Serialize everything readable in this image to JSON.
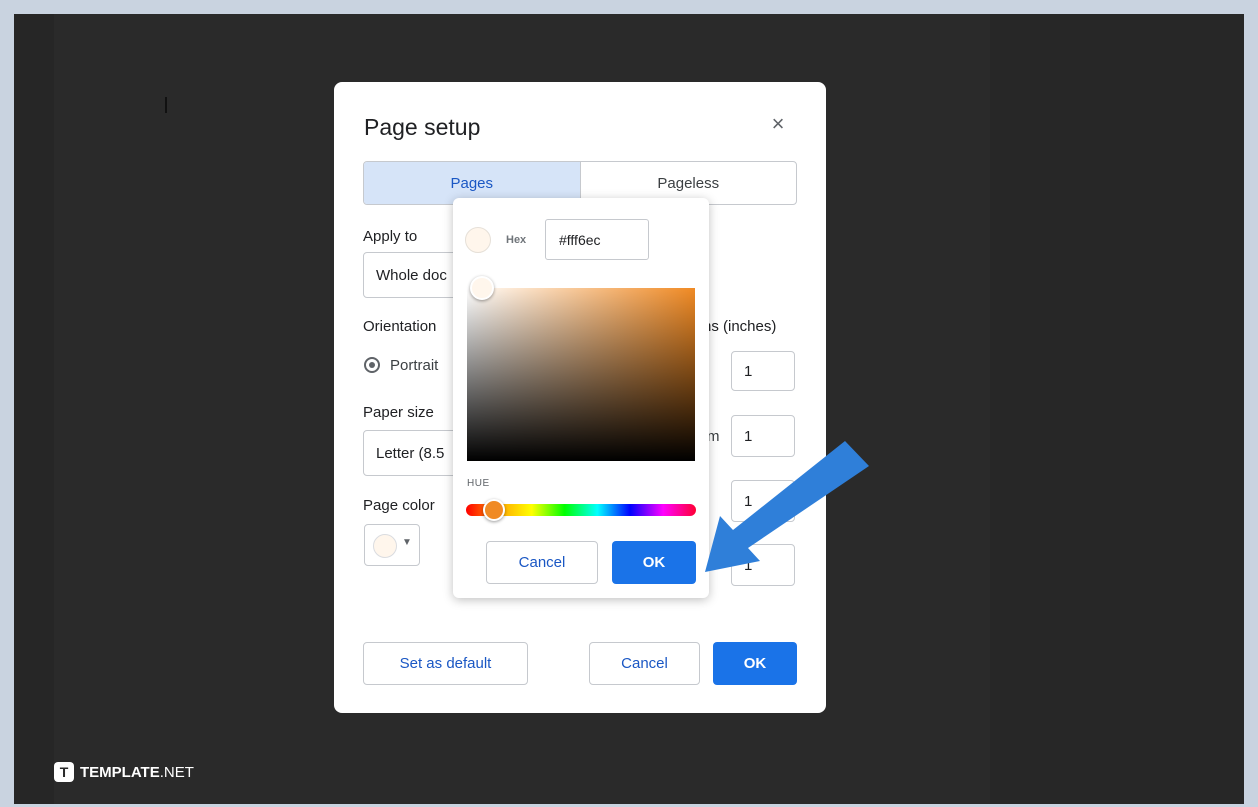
{
  "dialog": {
    "title": "Page setup",
    "tabs": [
      {
        "label": "Pages",
        "active": true
      },
      {
        "label": "Pageless",
        "active": false
      }
    ],
    "apply_to": {
      "label": "Apply to",
      "value": "Whole doc"
    },
    "orientation": {
      "label": "Orientation",
      "option": "Portrait"
    },
    "paper_size": {
      "label": "Paper size",
      "value": "Letter (8.5"
    },
    "page_color": {
      "label": "Page color"
    },
    "margins": {
      "label_suffix": "ns (inches)",
      "values": [
        "1",
        "1",
        "1",
        "1"
      ],
      "side_letter": "m"
    },
    "buttons": {
      "set_default": "Set as default",
      "cancel": "Cancel",
      "ok": "OK"
    }
  },
  "color_picker": {
    "hex_label": "Hex",
    "hex_value": "#fff6ec",
    "hue_label": "HUE",
    "cancel": "Cancel",
    "ok": "OK",
    "selected_color": "#fff6ec",
    "hue_color": "#f08a24"
  },
  "brand": {
    "logo": "T",
    "name_bold": "TEMPLATE",
    "name_suffix": ".NET"
  },
  "colors": {
    "accent": "#1a73e8",
    "arrow": "#2f7fd9",
    "backdrop": "#2a2a2a"
  }
}
